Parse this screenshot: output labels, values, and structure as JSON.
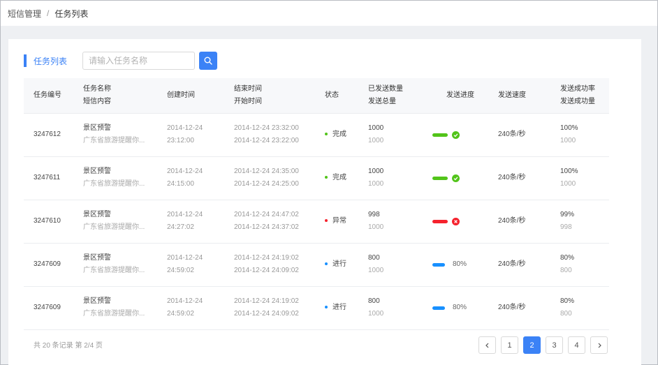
{
  "breadcrumb": {
    "parent": "短信管理",
    "separator": "/",
    "current": "任务列表"
  },
  "card": {
    "title": "任务列表",
    "search": {
      "placeholder": "请输入任务名称",
      "value": ""
    }
  },
  "columns": [
    {
      "line1": "任务编号",
      "line2": ""
    },
    {
      "line1": "任务名称",
      "line2": "短信内容"
    },
    {
      "line1": "创建时间",
      "line2": ""
    },
    {
      "line1": "结束时间",
      "line2": "开始时间"
    },
    {
      "line1": "状态",
      "line2": ""
    },
    {
      "line1": "已发送数量",
      "line2": "发送总量"
    },
    {
      "line1": "发送进度",
      "line2": ""
    },
    {
      "line1": "发送速度",
      "line2": ""
    },
    {
      "line1": "发送成功率",
      "line2": "发送成功量"
    }
  ],
  "rows": [
    {
      "id": "3247612",
      "name": "景区预警",
      "content": "广东省旅游提醒你...",
      "created_date": "2014-12-24",
      "created_time": "23:12:00",
      "end": "2014-12-24  23:32:00",
      "start": "2014-12-24  23:22:00",
      "status": "完成",
      "status_color": "#52c41a",
      "sent": "1000",
      "total": "1000",
      "progress": 1.0,
      "progress_color": "#52c41a",
      "progress_icon": "check-icon",
      "progress_text": "",
      "speed": "240条/秒",
      "success_rate": "100%",
      "success_count": "1000"
    },
    {
      "id": "3247611",
      "name": "景区预警",
      "content": "广东省旅游提醒你...",
      "created_date": "2014-12-24",
      "created_time": "24:15:00",
      "end": "2014-12-24  24:35:00",
      "start": "2014-12-24  24:25:00",
      "status": "完成",
      "status_color": "#52c41a",
      "sent": "1000",
      "total": "1000",
      "progress": 1.0,
      "progress_color": "#52c41a",
      "progress_icon": "check-icon",
      "progress_text": "",
      "speed": "240条/秒",
      "success_rate": "100%",
      "success_count": "1000"
    },
    {
      "id": "3247610",
      "name": "景区预警",
      "content": "广东省旅游提醒你...",
      "created_date": "2014-12-24",
      "created_time": "24:27:02",
      "end": "2014-12-24  24:47:02",
      "start": "2014-12-24  24:37:02",
      "status": "异常",
      "status_color": "#f5222d",
      "sent": "998",
      "total": "1000",
      "progress": 1.0,
      "progress_color": "#f5222d",
      "progress_icon": "error-icon",
      "progress_text": "",
      "speed": "240条/秒",
      "success_rate": "99%",
      "success_count": "998"
    },
    {
      "id": "3247609",
      "name": "景区预警",
      "content": "广东省旅游提醒你...",
      "created_date": "2014-12-24",
      "created_time": "24:59:02",
      "end": "2014-12-24  24:19:02",
      "start": "2014-12-24  24:09:02",
      "status": "进行",
      "status_color": "#1890ff",
      "sent": "800",
      "total": "1000",
      "progress": 0.8,
      "progress_color": "#1890ff",
      "progress_icon": "",
      "progress_text": "80%",
      "speed": "240条/秒",
      "success_rate": "80%",
      "success_count": "800"
    },
    {
      "id": "3247609",
      "name": "景区预警",
      "content": "广东省旅游提醒你...",
      "created_date": "2014-12-24",
      "created_time": "24:59:02",
      "end": "2014-12-24  24:19:02",
      "start": "2014-12-24  24:09:02",
      "status": "进行",
      "status_color": "#1890ff",
      "sent": "800",
      "total": "1000",
      "progress": 0.8,
      "progress_color": "#1890ff",
      "progress_icon": "",
      "progress_text": "80%",
      "speed": "240条/秒",
      "success_rate": "80%",
      "success_count": "800"
    }
  ],
  "footer": {
    "total_text": "共 20 条记录  第 2/4 页"
  },
  "pagination": {
    "prev_icon": "chevron-left-icon",
    "next_icon": "chevron-right-icon",
    "pages": [
      "1",
      "2",
      "3",
      "4"
    ],
    "current": "2"
  },
  "colors": {
    "accent": "#3b82f6",
    "success": "#52c41a",
    "error": "#f5222d",
    "running": "#1890ff"
  }
}
